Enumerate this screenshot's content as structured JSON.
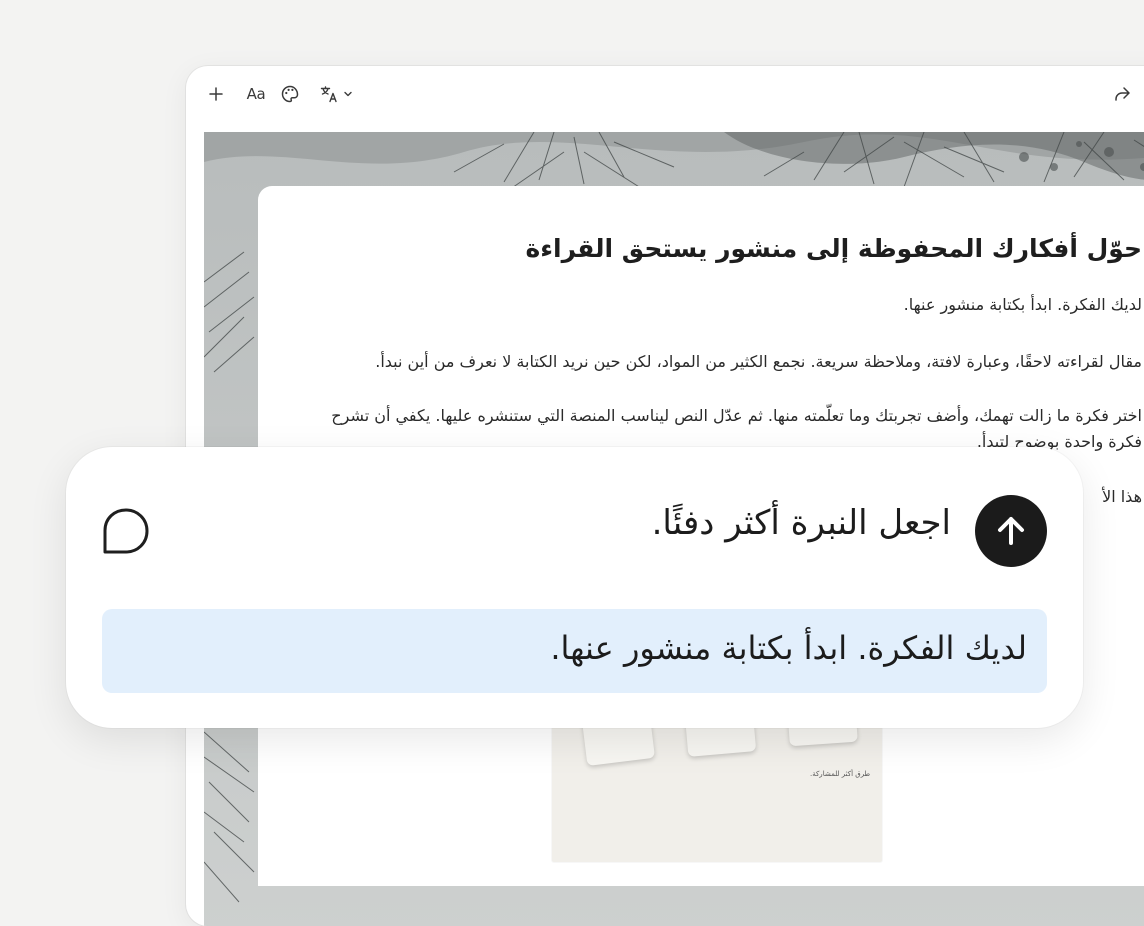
{
  "toolbar": {
    "format_label": "Aa",
    "icons": [
      "plus-icon",
      "palette-icon",
      "translate-icon",
      "chevron-down-icon",
      "share-icon"
    ]
  },
  "document": {
    "title": "حوّل أفكارك المحفوظة إلى منشور يستحق القراءة",
    "paragraphs": [
      "لديك الفكرة. ابدأ بكتابة منشور عنها.",
      "مقال لقراءته لاحقًا، وعبارة لافتة، وملاحظة سريعة. نجمع الكثير من المواد، لكن حين نريد الكتابة لا نعرف من أين نبدأ.",
      "اختر فكرة ما زالت تهمك، وأضف تجربتك وما تعلّمته منها. ثم عدّل النص ليناسب المنصة التي ستنشره عليها. يكفي أن تشرح فكرة واحدة بوضوح لتبدأ.",
      "هذا الأ"
    ],
    "thumbnail_caption": "طرق أكثر للمشاركة."
  },
  "prompt": {
    "text": "اجعل النبرة أكثر دفئًا.",
    "selected_text": "لديك الفكرة. ابدأ بكتابة منشور عنها.",
    "icons": [
      "comment-bubble-icon",
      "arrow-up-icon"
    ]
  },
  "colors": {
    "background": "#f3f3f2",
    "send_button": "#1b1b1b",
    "highlight": "#e2effc"
  }
}
